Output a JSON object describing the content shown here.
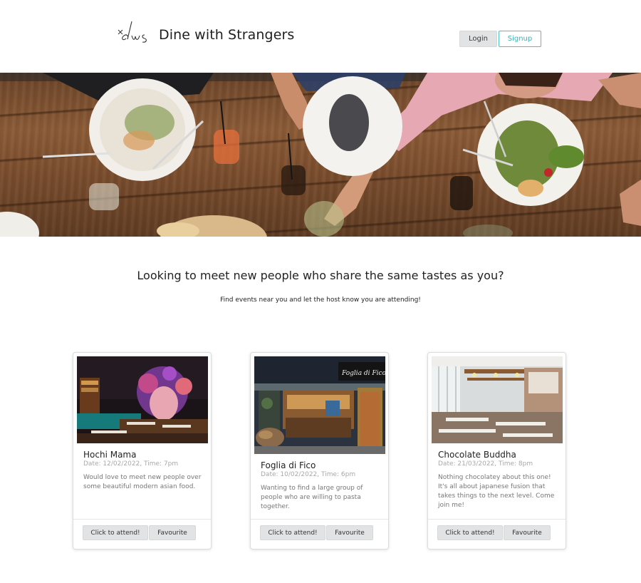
{
  "header": {
    "logo_icon": "dws-script-logo",
    "title": "Dine with Strangers",
    "login_label": "Login",
    "signup_label": "Signup",
    "accent_color": "#4fbfbf"
  },
  "hero": {
    "image": "people-sharing-food-on-wooden-table"
  },
  "intro": {
    "heading": "Looking to meet new people who share the same tastes as you?",
    "subheading": "Find events near you and let the host know you are attending!"
  },
  "events": [
    {
      "name": "Hochi Mama",
      "date": "Date: 12/02/2022, Time: 7pm",
      "description": "Would love to meet new people over some beautiful modern asian food.",
      "attend_label": "Click to attend!",
      "favourite_label": "Favourite"
    },
    {
      "name": "Foglia di Fico",
      "date": "Date: 10/02/2022, Time: 6pm",
      "description": "Wanting to find a large group of people who are willing to pasta together.",
      "attend_label": "Click to attend!",
      "favourite_label": "Favourite"
    },
    {
      "name": "Chocolate Buddha",
      "date": "Date: 21/03/2022, Time: 8pm",
      "description": "Nothing chocolatey about this one! It's all about japanese fusion that takes things to the next level. Come join me!",
      "attend_label": "Click to attend!",
      "favourite_label": "Favourite"
    }
  ]
}
